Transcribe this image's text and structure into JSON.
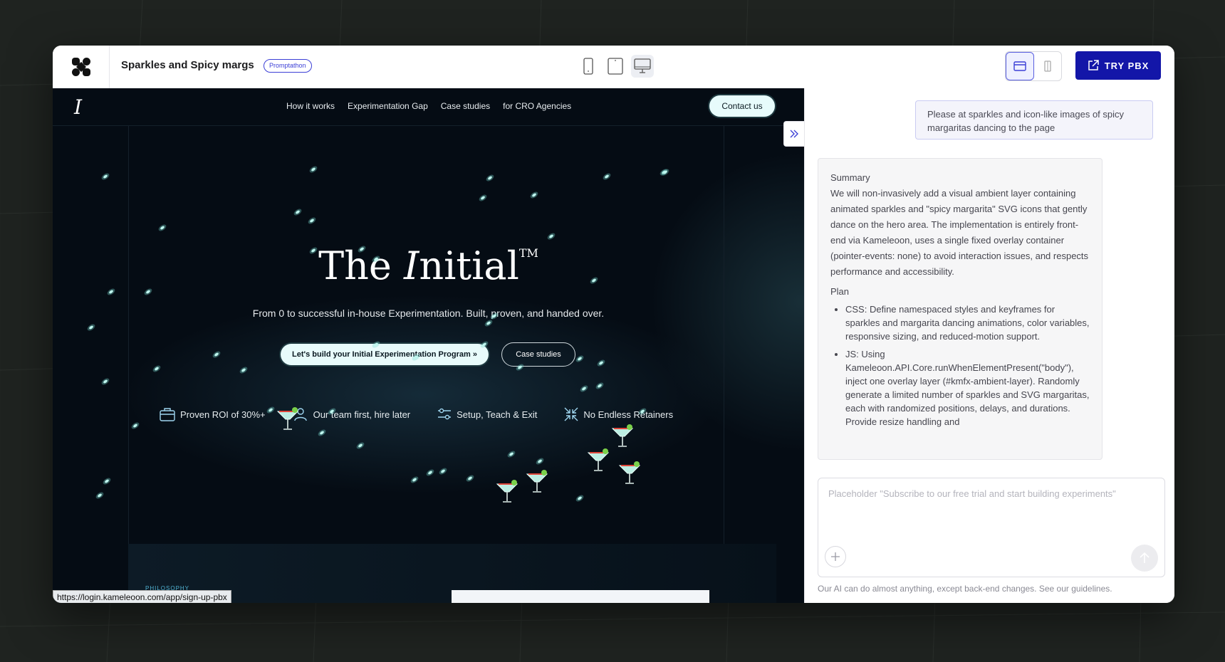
{
  "header": {
    "project_title": "Sparkles and Spicy margs",
    "badge": "Promptathon",
    "try_button": "TRY PBX"
  },
  "preview": {
    "nav_links": [
      "How it works",
      "Experimentation Gap",
      "Case studies",
      "for CRO Agencies"
    ],
    "contact_button": "Contact us",
    "hero_title": "The Initial",
    "hero_title_parts": {
      "the": "The ",
      "initial_i": "I",
      "initial_rest": "nitial",
      "tm": "TM"
    },
    "logo": "I",
    "hero_subtitle": "From 0 to successful in-house Experimentation. Built, proven, and handed over.",
    "cta_primary": "Let's build your Initial Experimentation Program »",
    "cta_secondary": "Case studies",
    "features": [
      "Proven ROI of 30%+",
      "Our team first, hire later",
      "Setup, Teach & Exit",
      "No Endless Retainers"
    ],
    "section_label": "PHILOSOPHY",
    "status_url": "https://login.kameleoon.com/app/sign-up-pbx"
  },
  "chat": {
    "user_message": "Please at sparkles and icon-like images of spicy margaritas dancing to the page",
    "ai_summary_heading": "Summary",
    "ai_summary_text": "We will non-invasively add a visual ambient layer containing animated sparkles and \"spicy margarita\" SVG icons that gently dance on the hero area. The implementation is entirely front-end via Kameleoon, uses a single fixed overlay container (pointer-events: none) to avoid interaction issues, and respects performance and accessibility.",
    "ai_plan_heading": "Plan",
    "ai_plan_items": [
      "CSS: Define namespaced styles and keyframes for sparkles and margarita dancing animations, color variables, responsive sizing, and reduced-motion support.",
      "JS: Using Kameleoon.API.Core.runWhenElementPresent(\"body\"), inject one overlay layer (#kmfx-ambient-layer). Randomly generate a limited number of sparkles and SVG margaritas, each with randomized positions, delays, and durations. Provide resize handling and"
    ],
    "composer_placeholder": "Placeholder \"Subscribe to our free trial and start building experiments\"",
    "disclaimer": "Our AI can do almost anything, except back-end changes. See our guidelines."
  },
  "colors": {
    "primary": "#1316a8",
    "accent_border": "#3b3fd6",
    "preview_bg": "#050c14",
    "page_bg": "#1f2320"
  },
  "icons": [
    "logo-icon",
    "phone-icon",
    "tablet-icon",
    "desktop-icon",
    "split-view-icon",
    "single-view-icon",
    "external-link-icon",
    "double-chevron-right-icon",
    "briefcase-icon",
    "team-icon",
    "settings-sliders-icon",
    "compress-icon",
    "plus-icon",
    "arrow-up-icon",
    "sparkle-icon",
    "margarita-icon"
  ]
}
